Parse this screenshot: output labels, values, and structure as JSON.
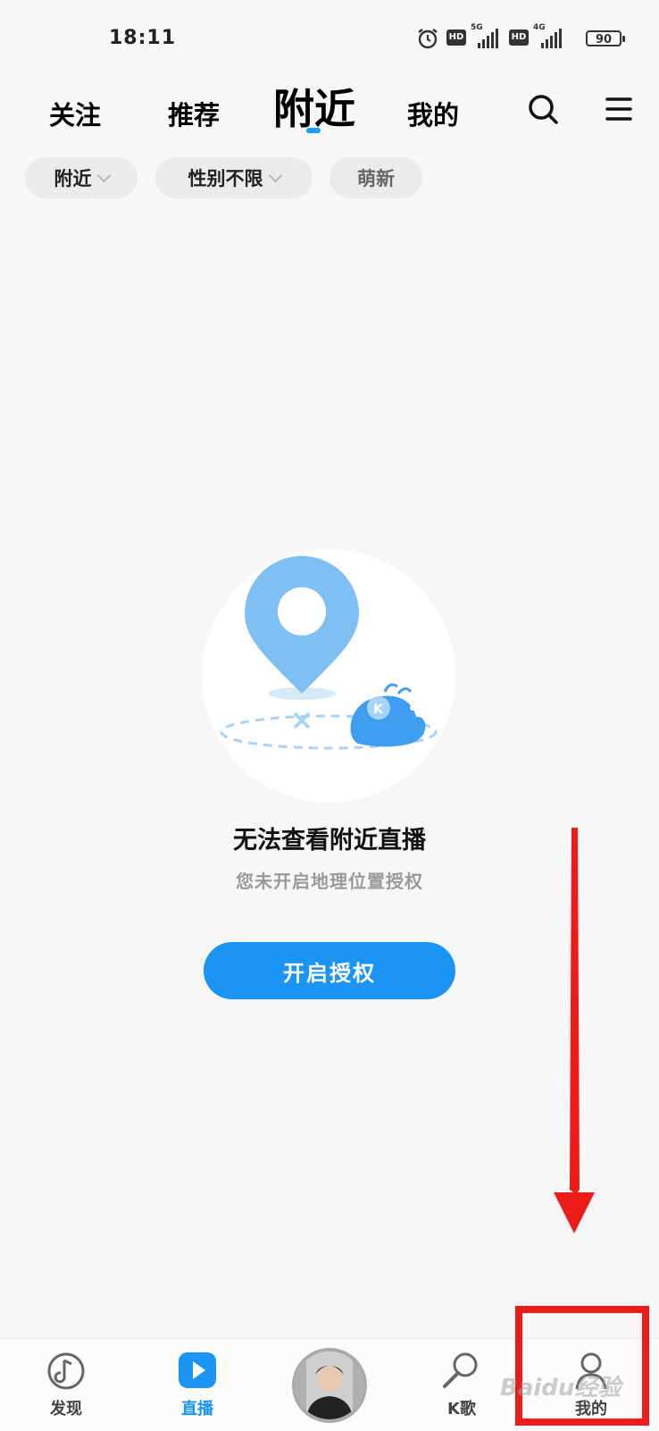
{
  "status_bar": {
    "time": "18:11",
    "net1_badge": "HD",
    "net1_gen": "5G",
    "net2_badge": "HD",
    "net2_gen": "4G",
    "battery": "90",
    "icons": [
      "alarm-icon",
      "signal-icon",
      "battery-icon"
    ]
  },
  "top_tabs": {
    "follow": "关注",
    "recommend": "推荐",
    "nearby": "附近",
    "mine": "我的",
    "active": "nearby",
    "accent_color": "#18a0f5"
  },
  "filters": {
    "location": "附近",
    "gender": "性别不限",
    "newbie": "萌新"
  },
  "empty_state": {
    "title": "无法查看附近直播",
    "subtitle": "您未开启地理位置授权",
    "button_label": "开启授权",
    "button_color": "#1a94f5"
  },
  "bottom_nav": {
    "discover": "发现",
    "live": "直播",
    "karaoke": "K歌",
    "mine": "我的",
    "active": "live"
  },
  "watermark": "Baidu经验",
  "annotation_color": "#ee1b1b"
}
